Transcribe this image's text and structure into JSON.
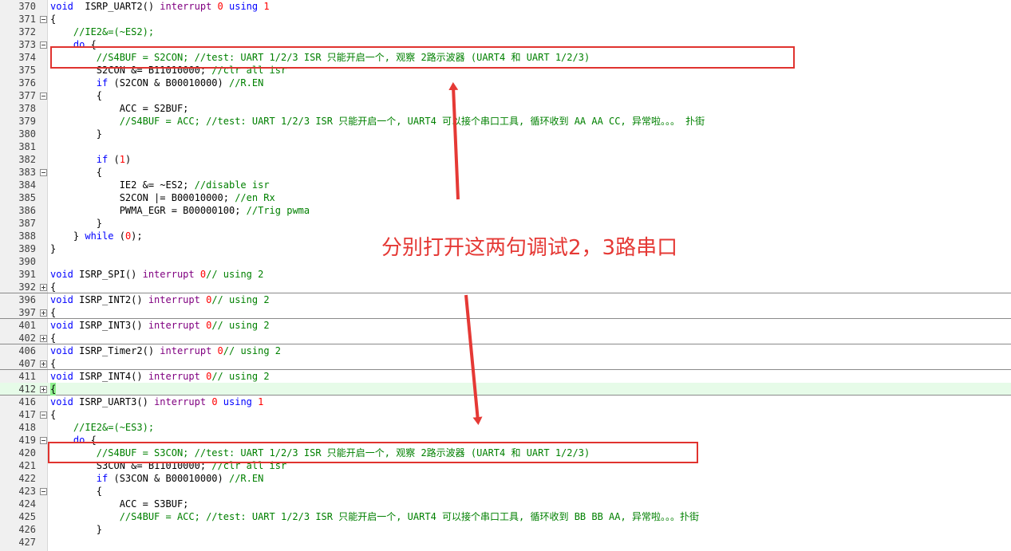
{
  "lines": [
    {
      "n": "370",
      "fold": "",
      "parts": [
        [
          "kw",
          "void"
        ],
        [
          "",
          "  ISRP_UART2() "
        ],
        [
          "kw2",
          "interrupt"
        ],
        [
          "",
          ""
        ],
        [
          "num",
          " 0"
        ],
        [
          "kw",
          " using"
        ],
        [
          "num",
          " 1"
        ]
      ]
    },
    {
      "n": "371",
      "fold": "minus",
      "parts": [
        [
          "",
          "{"
        ]
      ]
    },
    {
      "n": "372",
      "fold": "",
      "parts": [
        [
          "cm",
          "    //IE2&=(~ES2);"
        ]
      ]
    },
    {
      "n": "373",
      "fold": "minus",
      "parts": [
        [
          "kw",
          "    do"
        ],
        [
          "",
          " {"
        ]
      ]
    },
    {
      "n": "374",
      "fold": "",
      "parts": [
        [
          "cm",
          "        //S4BUF = S2CON; //test: UART 1/2/3 ISR 只能开启一个, 观察 2路示波器 (UART4 和 UART 1/2/3)"
        ]
      ]
    },
    {
      "n": "375",
      "fold": "",
      "parts": [
        [
          "",
          "        S2CON &= B11010000; "
        ],
        [
          "cm",
          "//clr all isr"
        ]
      ]
    },
    {
      "n": "376",
      "fold": "",
      "parts": [
        [
          "kw",
          "        if"
        ],
        [
          "",
          " (S2CON & B00010000) "
        ],
        [
          "cm",
          "//R.EN"
        ]
      ]
    },
    {
      "n": "377",
      "fold": "minus",
      "parts": [
        [
          "",
          "        {"
        ]
      ]
    },
    {
      "n": "378",
      "fold": "",
      "parts": [
        [
          "",
          "            ACC = S2BUF;"
        ]
      ]
    },
    {
      "n": "379",
      "fold": "",
      "parts": [
        [
          "cm",
          "            //S4BUF = ACC; //test: UART 1/2/3 ISR 只能开启一个, UART4 可以接个串口工具, 循环收到 AA AA CC, 异常啦。。。 扑街"
        ]
      ]
    },
    {
      "n": "380",
      "fold": "",
      "parts": [
        [
          "",
          "        }"
        ]
      ]
    },
    {
      "n": "381",
      "fold": "",
      "parts": [
        [
          "",
          ""
        ]
      ]
    },
    {
      "n": "382",
      "fold": "",
      "parts": [
        [
          "kw",
          "        if"
        ],
        [
          "",
          " ("
        ],
        [
          "num",
          "1"
        ],
        [
          "",
          ")"
        ]
      ]
    },
    {
      "n": "383",
      "fold": "minus",
      "parts": [
        [
          "",
          "        {"
        ]
      ]
    },
    {
      "n": "384",
      "fold": "",
      "parts": [
        [
          "",
          "            IE2 &= ~ES2; "
        ],
        [
          "cm",
          "//disable isr"
        ]
      ]
    },
    {
      "n": "385",
      "fold": "",
      "parts": [
        [
          "",
          "            S2CON |= B00010000; "
        ],
        [
          "cm",
          "//en Rx"
        ]
      ]
    },
    {
      "n": "386",
      "fold": "",
      "parts": [
        [
          "",
          "            PWMA_EGR = B00000100; "
        ],
        [
          "cm",
          "//Trig pwma"
        ]
      ]
    },
    {
      "n": "387",
      "fold": "",
      "parts": [
        [
          "",
          "        }"
        ]
      ]
    },
    {
      "n": "388",
      "fold": "",
      "parts": [
        [
          "",
          "    } "
        ],
        [
          "kw",
          "while"
        ],
        [
          "",
          " ("
        ],
        [
          "num",
          "0"
        ],
        [
          "",
          ");"
        ]
      ]
    },
    {
      "n": "389",
      "fold": "",
      "parts": [
        [
          "",
          "}"
        ]
      ]
    },
    {
      "n": "390",
      "fold": "",
      "parts": [
        [
          "",
          ""
        ]
      ]
    },
    {
      "n": "391",
      "fold": "",
      "parts": [
        [
          "kw",
          "void"
        ],
        [
          "",
          " ISRP_SPI() "
        ],
        [
          "kw2",
          "interrupt"
        ],
        [
          "num",
          " 0"
        ],
        [
          "cm",
          "// using 2"
        ]
      ]
    },
    {
      "n": "392",
      "fold": "plus",
      "folded": true,
      "parts": [
        [
          "",
          "{"
        ]
      ]
    },
    {
      "n": "396",
      "fold": "",
      "parts": [
        [
          "kw",
          "void"
        ],
        [
          "",
          " ISRP_INT2() "
        ],
        [
          "kw2",
          "interrupt"
        ],
        [
          "num",
          " 0"
        ],
        [
          "cm",
          "// using 2"
        ]
      ]
    },
    {
      "n": "397",
      "fold": "plus",
      "folded": true,
      "parts": [
        [
          "",
          "{"
        ]
      ]
    },
    {
      "n": "401",
      "fold": "",
      "parts": [
        [
          "kw",
          "void"
        ],
        [
          "",
          " ISRP_INT3() "
        ],
        [
          "kw2",
          "interrupt"
        ],
        [
          "num",
          " 0"
        ],
        [
          "cm",
          "// using 2"
        ]
      ]
    },
    {
      "n": "402",
      "fold": "plus",
      "folded": true,
      "parts": [
        [
          "",
          "{"
        ]
      ]
    },
    {
      "n": "406",
      "fold": "",
      "parts": [
        [
          "kw",
          "void"
        ],
        [
          "",
          " ISRP_Timer2() "
        ],
        [
          "kw2",
          "interrupt"
        ],
        [
          "num",
          " 0"
        ],
        [
          "cm",
          "// using 2"
        ]
      ]
    },
    {
      "n": "407",
      "fold": "plus",
      "folded": true,
      "parts": [
        [
          "",
          "{"
        ]
      ]
    },
    {
      "n": "411",
      "fold": "",
      "parts": [
        [
          "kw",
          "void"
        ],
        [
          "",
          " ISRP_INT4() "
        ],
        [
          "kw2",
          "interrupt"
        ],
        [
          "num",
          " 0"
        ],
        [
          "cm",
          "// using 2"
        ]
      ]
    },
    {
      "n": "412",
      "fold": "plus",
      "folded": true,
      "highlight": true,
      "parts": [
        [
          "",
          "{"
        ]
      ]
    },
    {
      "n": "416",
      "fold": "",
      "parts": [
        [
          "kw",
          "void"
        ],
        [
          "",
          " ISRP_UART3() "
        ],
        [
          "kw2",
          "interrupt"
        ],
        [
          "num",
          " 0"
        ],
        [
          "kw",
          " using"
        ],
        [
          "num",
          " 1"
        ]
      ]
    },
    {
      "n": "417",
      "fold": "minus",
      "parts": [
        [
          "",
          "{"
        ]
      ]
    },
    {
      "n": "418",
      "fold": "",
      "parts": [
        [
          "cm",
          "    //IE2&=(~ES3);"
        ]
      ]
    },
    {
      "n": "419",
      "fold": "minus",
      "parts": [
        [
          "kw",
          "    do"
        ],
        [
          "",
          " {"
        ]
      ]
    },
    {
      "n": "420",
      "fold": "",
      "parts": [
        [
          "cm",
          "        //S4BUF = S3CON; //test: UART 1/2/3 ISR 只能开启一个, 观察 2路示波器 (UART4 和 UART 1/2/3)"
        ]
      ]
    },
    {
      "n": "421",
      "fold": "",
      "parts": [
        [
          "",
          "        S3CON &= B11010000; "
        ],
        [
          "cm",
          "//clr all isr"
        ]
      ]
    },
    {
      "n": "422",
      "fold": "",
      "parts": [
        [
          "kw",
          "        if"
        ],
        [
          "",
          " (S3CON & B00010000) "
        ],
        [
          "cm",
          "//R.EN"
        ]
      ]
    },
    {
      "n": "423",
      "fold": "minus",
      "parts": [
        [
          "",
          "        {"
        ]
      ]
    },
    {
      "n": "424",
      "fold": "",
      "parts": [
        [
          "",
          "            ACC = S3BUF;"
        ]
      ]
    },
    {
      "n": "425",
      "fold": "",
      "parts": [
        [
          "cm",
          "            //S4BUF = ACC; //test: UART 1/2/3 ISR 只能开启一个, UART4 可以接个串口工具, 循环收到 BB BB AA, 异常啦。。。扑街"
        ]
      ]
    },
    {
      "n": "426",
      "fold": "",
      "parts": [
        [
          "",
          "        }"
        ]
      ]
    },
    {
      "n": "427",
      "fold": "",
      "parts": [
        [
          "",
          ""
        ]
      ]
    }
  ],
  "annotation": {
    "text": "分别打开这两句调试2，3路串口",
    "color": "#e53935"
  }
}
